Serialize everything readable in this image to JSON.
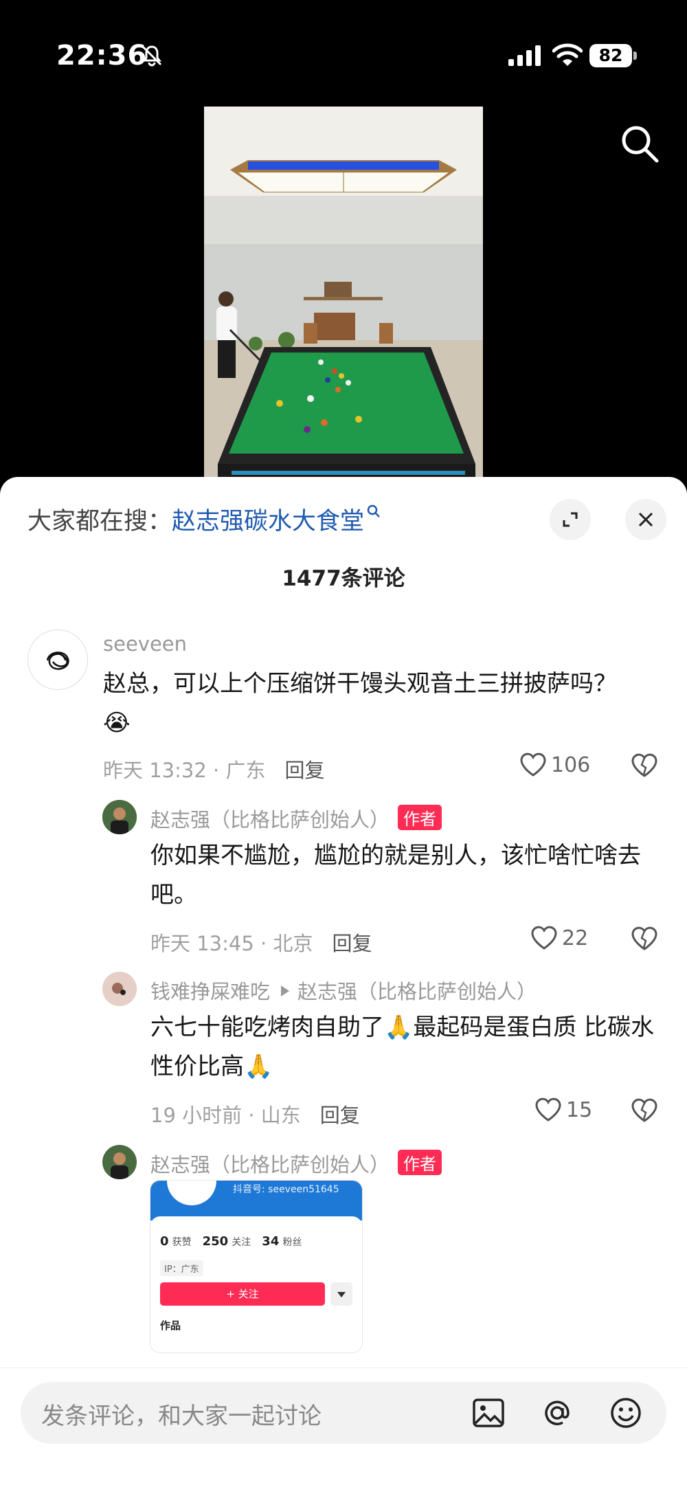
{
  "status_bar": {
    "time": "22:36",
    "battery": "82"
  },
  "sheet": {
    "hot_search_label": "大家都在搜：",
    "hot_search_term": "赵志强碳水大食堂",
    "comment_count": "1477条评论"
  },
  "comments": [
    {
      "username": "seeveen",
      "text": "赵总，可以上个压缩饼干馒头观音土三拼披萨吗？",
      "emoji": "😭",
      "time_location": "昨天 13:32 · 广东",
      "reply_label": "回复",
      "likes": "106"
    }
  ],
  "replies": [
    {
      "username": "赵志强（比格比萨创始人）",
      "badge": "作者",
      "text": "你如果不尴尬，尴尬的就是别人，该忙啥忙啥去吧。",
      "time_location": "昨天 13:45 · 北京",
      "reply_label": "回复",
      "likes": "22"
    },
    {
      "username": "钱难挣屎难吃",
      "reply_to": "赵志强（比格比萨创始人）",
      "text_a": "六七十能吃烤肉自助了",
      "emoji_a": "🙏",
      "text_b": "最起码是蛋白质 比碳水性价比高",
      "emoji_b": "🙏",
      "time_location": "19 小时前 · 山东",
      "reply_label": "回复",
      "likes": "15"
    },
    {
      "username": "赵志强（比格比萨创始人）",
      "badge": "作者"
    }
  ],
  "image_comment": {
    "douyin_id": "抖音号: seeveen51645",
    "stats": [
      {
        "value": "0",
        "label": "获赞"
      },
      {
        "value": "250",
        "label": "关注"
      },
      {
        "value": "34",
        "label": "粉丝"
      }
    ],
    "ip": "IP：广东",
    "follow_label": "+ 关注",
    "works_label": "作品"
  },
  "input": {
    "placeholder": "发条评论，和大家一起讨论"
  },
  "icons": [
    "mute-bell-icon",
    "signal-icon",
    "wifi-icon",
    "battery-icon",
    "search-icon",
    "expand-icon",
    "close-icon",
    "heart-icon",
    "dislike-icon",
    "image-icon",
    "at-icon",
    "emoji-icon"
  ],
  "colors": {
    "author_badge": "#fe2c55",
    "hot_search_term": "#1f5bb0",
    "table_felt": "#1f9a4a"
  }
}
